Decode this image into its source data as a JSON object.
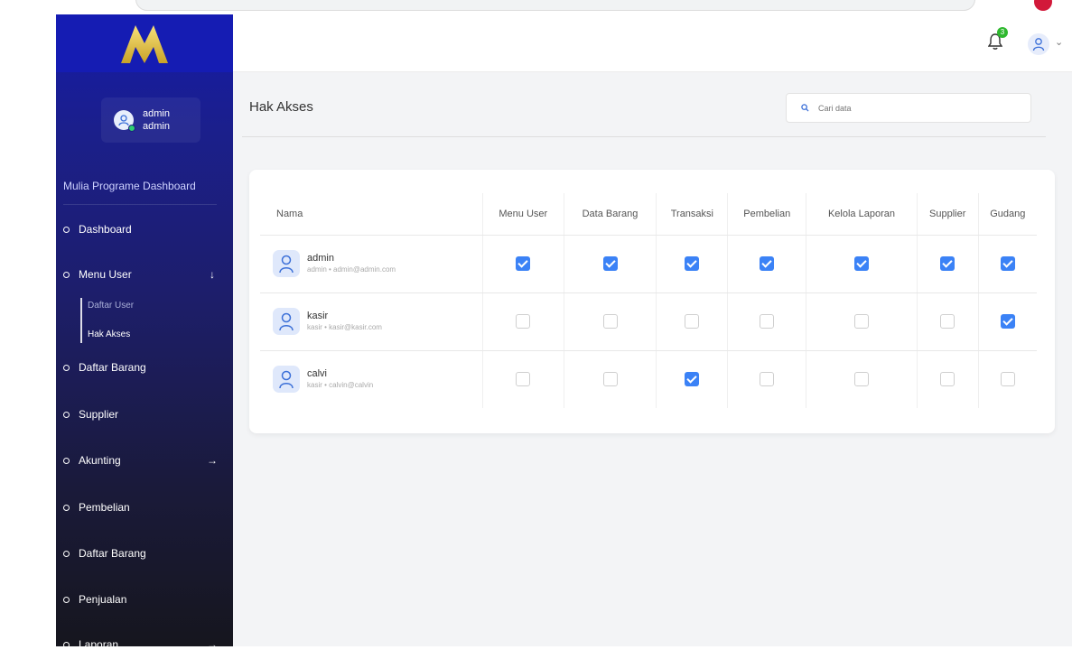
{
  "sidebar": {
    "user": {
      "name": "admin",
      "role": "admin"
    },
    "brand": "Mulia Programe Dashboard",
    "items": [
      {
        "label": "Dashboard"
      },
      {
        "label": "Menu User"
      },
      {
        "label": "Daftar Barang"
      },
      {
        "label": "Supplier"
      },
      {
        "label": "Akunting"
      },
      {
        "label": "Pembelian"
      },
      {
        "label": "Daftar Barang"
      },
      {
        "label": "Penjualan"
      },
      {
        "label": "Laporan"
      }
    ],
    "submenu": [
      {
        "label": "Daftar User"
      },
      {
        "label": "Hak Akses"
      }
    ]
  },
  "header": {
    "notification_count": "3"
  },
  "main": {
    "title": "Hak Akses",
    "search": {
      "placeholder": "Cari data"
    }
  },
  "table": {
    "columns": [
      "Nama",
      "Menu User",
      "Data Barang",
      "Transaksi",
      "Pembelian",
      "Kelola Laporan",
      "Supplier",
      "Gudang"
    ],
    "rows": [
      {
        "name": "admin",
        "sub": "admin • admin@admin.com",
        "perms": [
          true,
          true,
          true,
          true,
          true,
          true,
          true
        ]
      },
      {
        "name": "kasir",
        "sub": "kasir • kasir@kasir.com",
        "perms": [
          false,
          false,
          false,
          false,
          false,
          false,
          true
        ]
      },
      {
        "name": "calvi",
        "sub": "kasir • calvin@calvin",
        "perms": [
          false,
          false,
          true,
          false,
          false,
          false,
          false
        ]
      }
    ]
  },
  "colors": {
    "sidebar_top": "#151cb3",
    "checkbox_on": "#3b82f6",
    "badge": "#2eb82e"
  }
}
